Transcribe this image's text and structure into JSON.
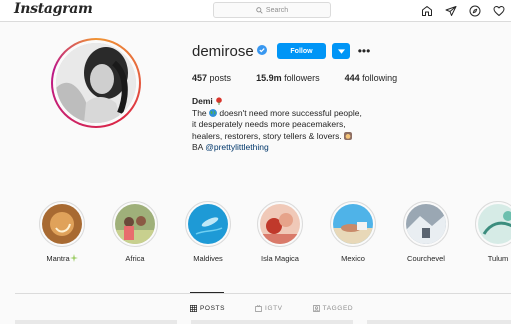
{
  "nav": {
    "logo": "Instagram",
    "search_placeholder": "Search",
    "icons": [
      "home-icon",
      "direct-message-icon",
      "explore-icon",
      "activity-heart-icon"
    ]
  },
  "profile": {
    "username": "demirose",
    "verified": true,
    "follow_label": "Follow",
    "more_label": "•••",
    "stats": {
      "posts_count": "457",
      "posts_label": "posts",
      "followers_count": "15.9m",
      "followers_label": "followers",
      "following_count": "444",
      "following_label": "following"
    },
    "bio": {
      "name": "Demi",
      "line1_pre": "The",
      "line1_post": "doesn't need more successful people,",
      "line2": "it desperately needs more peacemakers,",
      "line3": "healers, restorers, story tellers & lovers.",
      "line4_pre": "BA",
      "line4_link": "@prettylittlething"
    }
  },
  "highlights": [
    {
      "label": "Mantra",
      "icon": "mantra-highlight"
    },
    {
      "label": "Africa",
      "icon": "africa-highlight"
    },
    {
      "label": "Maldives",
      "icon": "maldives-highlight"
    },
    {
      "label": "Isla Magica",
      "icon": "isla-magica-highlight"
    },
    {
      "label": "Mexico",
      "icon": "mexico-highlight"
    },
    {
      "label": "Courchevel",
      "icon": "courchevel-highlight"
    },
    {
      "label": "Tulum",
      "icon": "tulum-highlight"
    }
  ],
  "tabs": [
    {
      "label": "POSTS",
      "active": true,
      "icon": "grid-icon"
    },
    {
      "label": "IGTV",
      "active": false,
      "icon": "igtv-icon"
    },
    {
      "label": "TAGGED",
      "active": false,
      "icon": "tagged-icon"
    }
  ],
  "colors": {
    "accent": "#0095f6",
    "link": "#00376b",
    "text": "#262626",
    "muted": "#8e8e8e",
    "border": "#dbdbdb"
  }
}
